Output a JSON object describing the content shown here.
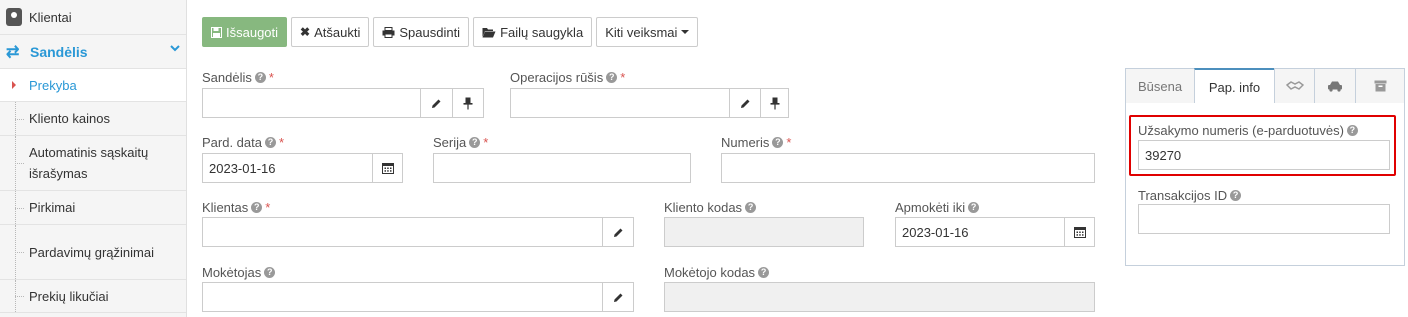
{
  "sidebar": {
    "top_label": "Klientai",
    "section_label": "Sandėlis",
    "items": [
      {
        "label": "Prekyba"
      },
      {
        "label": "Kliento kainos"
      },
      {
        "label": "Automatinis sąskaitų išrašymas"
      },
      {
        "label": "Pirkimai"
      },
      {
        "label": "Pardavimų grąžinimai"
      },
      {
        "label": "Prekių likučiai"
      }
    ]
  },
  "toolbar": {
    "save": "Išsaugoti",
    "cancel": "Atšaukti",
    "print": "Spausdinti",
    "files": "Failų saugykla",
    "other": "Kiti veiksmai"
  },
  "form": {
    "warehouse": {
      "label": "Sandėlis",
      "value": ""
    },
    "operation_type": {
      "label": "Operacijos rūšis",
      "value": ""
    },
    "sale_date": {
      "label": "Pard. data",
      "value": "2023-01-16"
    },
    "series": {
      "label": "Serija",
      "value": ""
    },
    "number": {
      "label": "Numeris",
      "value": ""
    },
    "client": {
      "label": "Klientas",
      "value": ""
    },
    "client_code": {
      "label": "Kliento kodas",
      "value": ""
    },
    "pay_until": {
      "label": "Apmokėti iki",
      "value": "2023-01-16"
    },
    "payer": {
      "label": "Mokėtojas",
      "value": ""
    },
    "payer_code": {
      "label": "Mokėtojo kodas",
      "value": ""
    }
  },
  "panel": {
    "tabs": [
      "Būsena",
      "Pap. info"
    ],
    "active_tab": "Pap. info",
    "icon_tabs": [
      "handshake-icon",
      "car-icon",
      "archive-icon"
    ],
    "order_number": {
      "label": "Užsakymo numeris (e-parduotuvės)",
      "value": "39270"
    },
    "transaction_id": {
      "label": "Transakcijos ID",
      "value": ""
    }
  },
  "colors": {
    "accent": "#2a98d6",
    "save_button": "#87b87f",
    "required": "#d9534f",
    "highlight": "#e00000"
  }
}
